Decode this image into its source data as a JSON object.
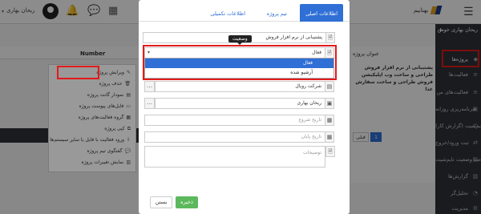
{
  "topbar": {
    "user_name": "ریحان بهاری",
    "logo_text": "بهنابیم",
    "icons": [
      "avatar",
      "bell-icon",
      "chat-icon",
      "calendar-icon",
      "hamburger-icon"
    ]
  },
  "sidebar": {
    "greeting": "ریحان بهاری خوش آمدید",
    "items": [
      {
        "label": "پروژه‌ها",
        "icon": "projects-icon",
        "active": true
      },
      {
        "label": "فعالیت‌ها",
        "icon": "activities-icon"
      },
      {
        "label": "فعالیت‌های من",
        "icon": "my-activities-icon"
      },
      {
        "label": "برنامه‌ریزی روزانه",
        "icon": "daily-plan-icon"
      },
      {
        "label": "تایم‌شیت (گزارش کار)",
        "icon": "timesheet-icon"
      },
      {
        "label": "ثبت ورود/خروج",
        "icon": "checkin-icon"
      },
      {
        "label": "خلاصه وضعیت تایم‌شیت",
        "icon": "summary-icon"
      },
      {
        "label": "گزارش‌ها",
        "icon": "reports-icon"
      },
      {
        "label": "تحلیل‌گر",
        "icon": "analyzer-icon"
      },
      {
        "label": "مدیریت",
        "icon": "admin-icon"
      }
    ]
  },
  "background": {
    "number_header": "Number",
    "title_header": "عنوان پروژه",
    "description": "پشتیبانی از نرم افزار فروش طراحی و ساخت وب اپلیکیشن فروش طراحی و ساخت سفارش غذا",
    "pagination": {
      "prev": "قبلی",
      "page": "1"
    }
  },
  "context_menu": {
    "items": [
      {
        "label": "ویرایش پروژه",
        "icon": "edit-icon"
      },
      {
        "label": "حذف پروژه",
        "icon": "trash-icon"
      },
      {
        "label": "نمودار گانت پروژه",
        "icon": "gantt-icon"
      },
      {
        "label": "فایل‌های پیوست پروژه",
        "icon": "attachment-icon"
      },
      {
        "label": "گروه فعالیت‌های پروژه",
        "icon": "group-icon"
      },
      {
        "label": "کپی پروژه",
        "icon": "copy-icon"
      },
      {
        "label": "ورود فعالیت با فایل یا سایر سیستم‌ها",
        "icon": "import-icon"
      },
      {
        "label": "گفتگوی تیم پروژه",
        "icon": "chat-icon"
      },
      {
        "label": "نمایش تغییرات پروژه",
        "icon": "history-icon"
      }
    ]
  },
  "modal": {
    "tabs": [
      {
        "label": "اطلاعات اصلی",
        "active": true
      },
      {
        "label": "تیم پروژه"
      },
      {
        "label": "اطلاعات تکمیلی"
      }
    ],
    "fields": {
      "title_value": "پشتیبانی از نرم افزار فروش",
      "status_value": "فعال",
      "status_tooltip": "وضعیت",
      "status_options": [
        "فعال",
        "آرشیو شده"
      ],
      "company_value": "شرکت رویال",
      "manager_value": "ریحان بهاری",
      "start_date_placeholder": "تاریخ شروع",
      "end_date_placeholder": "تاریخ پایان",
      "description_placeholder": "توضیحات"
    },
    "buttons": {
      "save": "ذخیره",
      "close": "بستن"
    }
  },
  "colors": {
    "accent": "#2f6fd6",
    "save_green": "#5cb85c",
    "highlight_red": "#e21b1b",
    "sidebar_bg": "#2f3238"
  }
}
